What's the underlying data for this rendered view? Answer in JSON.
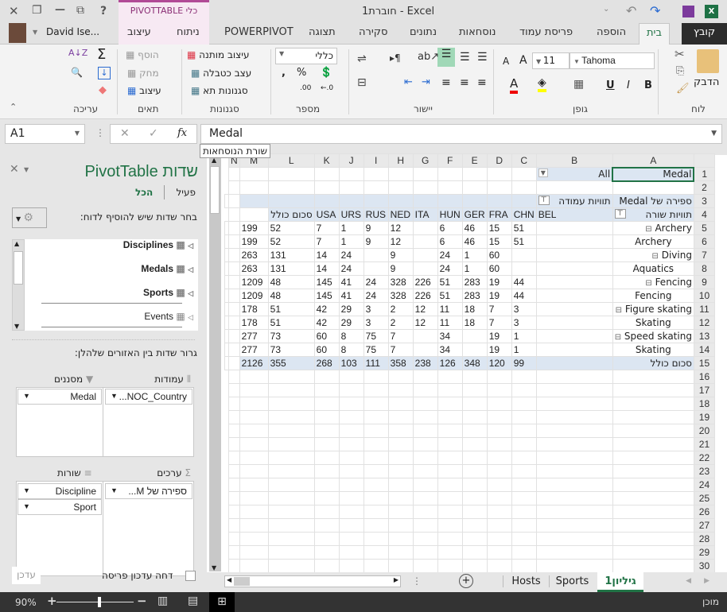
{
  "window": {
    "title": "Excel - חוברת1",
    "user": "David Ise...",
    "close": "✕",
    "restore": "❐",
    "minimize": "—",
    "ribbon_display": "⧉",
    "help": "?"
  },
  "qat": {
    "customize": "⌄",
    "undo": "↶",
    "redo": "↷",
    "save": "💾"
  },
  "context_tab": {
    "title": "כלי PIVOTTABLE",
    "tabs": [
      "ניתוח",
      "עיצוב"
    ]
  },
  "tabs": [
    "קובץ",
    "בית",
    "הוספה",
    "פריסת עמוד",
    "נוסחאות",
    "נתונים",
    "סקירה",
    "תצוגה",
    "POWERPIVOT"
  ],
  "ribbon": {
    "clipboard": {
      "label": "לוח",
      "paste": "הדבק"
    },
    "font": {
      "label": "גופן",
      "name": "Tahoma",
      "size": "11",
      "bold": "B",
      "italic": "I",
      "underline": "U"
    },
    "alignment": {
      "label": "יישור"
    },
    "number": {
      "label": "מספר",
      "format": "כללי"
    },
    "styles": {
      "label": "סגנונות",
      "conditional": "עיצוב מותנה",
      "table": "עצב כטבלה",
      "cell": "סגנונות תא"
    },
    "cells": {
      "label": "תאים",
      "insert": "הוסף",
      "delete": "מחק",
      "format": "עיצוב"
    },
    "editing": {
      "label": "עריכה"
    }
  },
  "formula_bar": {
    "name_box": "A1",
    "value": "Medal",
    "tooltip": "שורת הנוסחאות"
  },
  "pivot_pane": {
    "title": "שדות PivotTable",
    "tab_active": "פעיל",
    "tab_all": "הכל",
    "choose_label": "בחר שדות שיש להוסיף לדוח:",
    "tables": [
      {
        "name": "Disciplines",
        "bold": true
      },
      {
        "name": "Medals",
        "bold": true
      },
      {
        "name": "Sports",
        "bold": true
      },
      {
        "name": "Events",
        "bold": false
      }
    ],
    "drag_label": "גרור שדות בין האזורים שלהלן:",
    "areas": {
      "filters": {
        "label": "מסננים",
        "fields": [
          "Medal"
        ]
      },
      "columns": {
        "label": "עמודות",
        "fields": [
          "NOC_Country..."
        ]
      },
      "rows": {
        "label": "שורות",
        "fields": [
          "Discipline",
          "Sport"
        ]
      },
      "values": {
        "label": "ערכים",
        "fields": [
          "ספירה של M..."
        ]
      }
    },
    "defer_label": "דחה עדכון פריסה",
    "update_button": "עדכן"
  },
  "sheet": {
    "columns": [
      "A",
      "B",
      "C",
      "D",
      "E",
      "F",
      "G",
      "H",
      "I",
      "J",
      "K",
      "L",
      "M",
      "N"
    ],
    "row_numbers": [
      1,
      2,
      3,
      4,
      5,
      6,
      7,
      8,
      9,
      10,
      11,
      12,
      13,
      14,
      15,
      16,
      17,
      18,
      19,
      20,
      21,
      22,
      23,
      24,
      25,
      26,
      27,
      28,
      29,
      30
    ],
    "filter": {
      "field": "Medal",
      "value": "All"
    },
    "value_header": "ספירה של Medal",
    "col_labels": "תוויות עמודה",
    "row_labels": "תוויות שורה",
    "countries": [
      "BEL",
      "CHN",
      "FRA",
      "GER",
      "HUN",
      "ITA",
      "NED",
      "RUS",
      "URS",
      "USA"
    ],
    "grand_total_label": "סכום כולל",
    "rows": [
      {
        "label": "Archery",
        "bold": true,
        "vals": [
          "51",
          "15",
          "46",
          "6",
          "",
          "12",
          "9",
          "1",
          "7",
          "52"
        ],
        "total": "199"
      },
      {
        "label": "Archery",
        "bold": false,
        "vals": [
          "51",
          "15",
          "46",
          "6",
          "",
          "12",
          "9",
          "1",
          "7",
          "52"
        ],
        "total": "199"
      },
      {
        "label": "Diving",
        "bold": true,
        "vals": [
          "",
          "60",
          "1",
          "24",
          "",
          "9",
          "",
          "24",
          "14",
          "131"
        ],
        "total": "263"
      },
      {
        "label": "Aquatics",
        "bold": false,
        "vals": [
          "",
          "60",
          "1",
          "24",
          "",
          "9",
          "",
          "24",
          "14",
          "131"
        ],
        "total": "263"
      },
      {
        "label": "Fencing",
        "bold": true,
        "vals": [
          "44",
          "19",
          "283",
          "51",
          "226",
          "328",
          "24",
          "41",
          "145",
          "48"
        ],
        "total": "1209"
      },
      {
        "label": "Fencing",
        "bold": false,
        "vals": [
          "44",
          "19",
          "283",
          "51",
          "226",
          "328",
          "24",
          "41",
          "145",
          "48"
        ],
        "total": "1209"
      },
      {
        "label": "Figure skating",
        "bold": true,
        "vals": [
          "3",
          "7",
          "18",
          "11",
          "12",
          "2",
          "3",
          "29",
          "42",
          "51"
        ],
        "total": "178"
      },
      {
        "label": "Skating",
        "bold": false,
        "vals": [
          "3",
          "7",
          "18",
          "11",
          "12",
          "2",
          "3",
          "29",
          "42",
          "51"
        ],
        "total": "178"
      },
      {
        "label": "Speed skating",
        "bold": true,
        "vals": [
          "1",
          "19",
          "",
          "34",
          "",
          "7",
          "75",
          "8",
          "60",
          "73"
        ],
        "total": "277"
      },
      {
        "label": "Skating",
        "bold": false,
        "vals": [
          "1",
          "19",
          "",
          "34",
          "",
          "7",
          "75",
          "8",
          "60",
          "73"
        ],
        "total": "277"
      }
    ],
    "grand_total": {
      "vals": [
        "99",
        "120",
        "348",
        "126",
        "238",
        "358",
        "111",
        "103",
        "268",
        "355"
      ],
      "total": "2126"
    }
  },
  "sheet_tabs": [
    "גיליון1",
    "Sports",
    "Hosts"
  ],
  "status": {
    "ready": "מוכן",
    "zoom": "90%"
  }
}
